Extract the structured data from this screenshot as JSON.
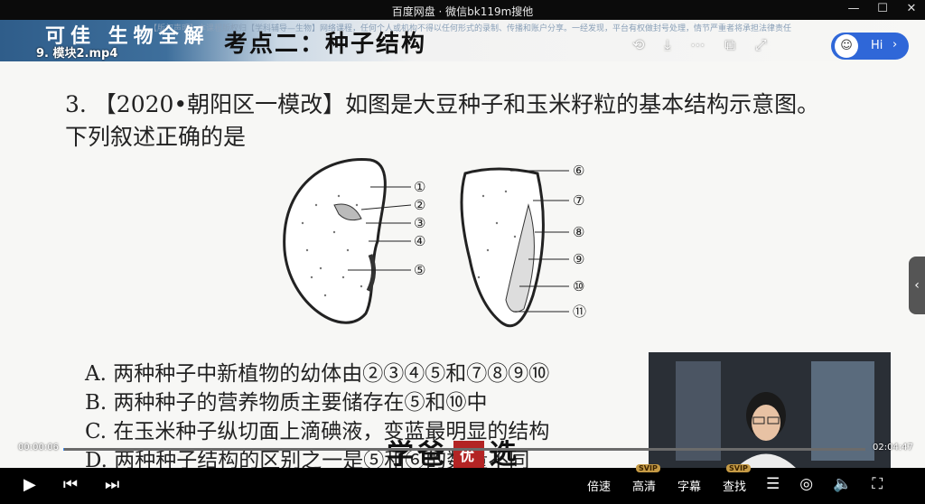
{
  "window": {
    "title": "百度网盘 · 微信bk119m搜他",
    "controls": [
      "minimize",
      "maximize",
      "close"
    ]
  },
  "video": {
    "filename": "9. 模块2.mp4",
    "banner_brand": "可佳 生物全解",
    "headline": "考点二：种子结构",
    "notice": "【版权声明】本课程版权归【学科辅导—生物】网络课程，任何个人或机构不得以任何形式的录制、传播和账户分享。一经发现，平台有权做封号处理，情节严重者将承担法律责任",
    "question": "3. 【2020•朝阳区一模改】如图是大豆种子和玉米籽粒的基本结构示意图。下列叙述正确的是",
    "options": [
      "A. 两种种子中新植物的幼体由②③④⑤和⑦⑧⑨⑩",
      "B. 两种种子的营养物质主要储存在⑤和⑩中",
      "C. 在玉米种子纵切面上滴碘液，变蓝最明显的结构",
      "D. 两种种子结构的区别之一是⑤和⑥的数量不同"
    ],
    "diagram_labels": [
      "①",
      "②",
      "③",
      "④",
      "⑤",
      "⑥",
      "⑦",
      "⑧",
      "⑨",
      "⑩",
      "⑪"
    ],
    "watermark_left": "学爸",
    "watermark_seal": "优",
    "watermark_right": "选"
  },
  "player": {
    "current_time": "00:00:06",
    "total_time": "02:04:47",
    "progress": 0.0008,
    "speed_label": "倍速",
    "quality_label": "高清",
    "subtitle_label": "字幕",
    "search_label": "查找",
    "svip_badge": "SVIP",
    "hi_label": "Hi"
  },
  "colors": {
    "accent": "#3a8cff",
    "hi_bubble": "#2f67d8",
    "svip": "#c59a45"
  }
}
